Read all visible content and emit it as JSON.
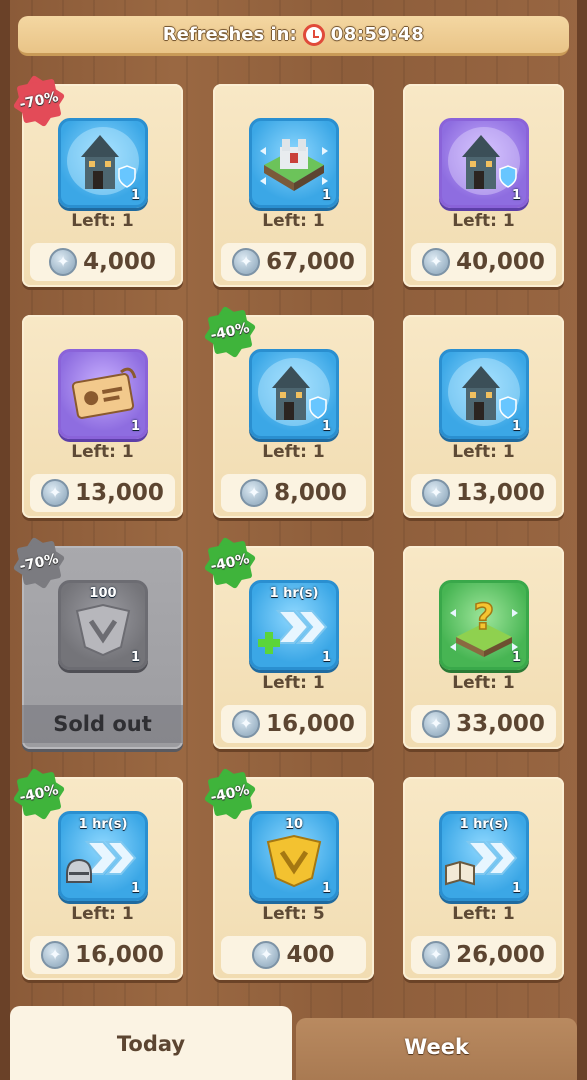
{
  "banner": {
    "label": "Refreshes in:",
    "time": "08:59:48"
  },
  "items": [
    {
      "discount": "-70%",
      "discount_color": "#e34b58",
      "tile": "blue",
      "icon": "castle-shield-icon",
      "top": "",
      "qty": "1",
      "left": "Left: 1",
      "price": "4,000"
    },
    {
      "discount": "",
      "tile": "blue",
      "icon": "fortress-move-icon",
      "top": "",
      "qty": "1",
      "left": "Left: 1",
      "price": "67,000"
    },
    {
      "discount": "",
      "tile": "purple",
      "icon": "castle-shield-icon",
      "top": "",
      "qty": "1",
      "left": "Left: 1",
      "price": "40,000"
    },
    {
      "discount": "",
      "tile": "purple",
      "icon": "id-card-icon",
      "top": "",
      "qty": "1",
      "left": "Left: 1",
      "price": "13,000"
    },
    {
      "discount": "-40%",
      "discount_color": "#3fb43b",
      "tile": "blue",
      "icon": "castle-shield-icon",
      "top": "",
      "qty": "1",
      "left": "Left: 1",
      "price": "8,000"
    },
    {
      "discount": "",
      "tile": "blue",
      "icon": "castle-shield-icon",
      "top": "",
      "qty": "1",
      "left": "Left: 1",
      "price": "13,000"
    },
    {
      "discount": "-70%",
      "discount_color": "#7b7b80",
      "tile": "gray",
      "icon": "shield-badge-icon",
      "top": "100",
      "qty": "1",
      "left": "",
      "price": "",
      "sold": "Sold out"
    },
    {
      "discount": "-40%",
      "discount_color": "#3fb43b",
      "tile": "blue",
      "icon": "speedup-plus-icon",
      "top": "1 hr(s)",
      "qty": "1",
      "left": "Left: 1",
      "price": "16,000"
    },
    {
      "discount": "",
      "tile": "green",
      "icon": "mystery-tile-icon",
      "top": "",
      "qty": "1",
      "left": "Left: 1",
      "price": "33,000"
    },
    {
      "discount": "-40%",
      "discount_color": "#3fb43b",
      "tile": "blue",
      "icon": "speedup-helmet-icon",
      "top": "1 hr(s)",
      "qty": "1",
      "left": "Left: 1",
      "price": "16,000"
    },
    {
      "discount": "-40%",
      "discount_color": "#3fb43b",
      "tile": "blue",
      "icon": "gold-shield-icon",
      "top": "10",
      "qty": "1",
      "left": "Left: 5",
      "price": "400"
    },
    {
      "discount": "",
      "tile": "blue",
      "icon": "speedup-book-icon",
      "top": "1 hr(s)",
      "qty": "1",
      "left": "Left: 1",
      "price": "26,000"
    }
  ],
  "tabs": {
    "today": "Today",
    "week": "Week"
  }
}
